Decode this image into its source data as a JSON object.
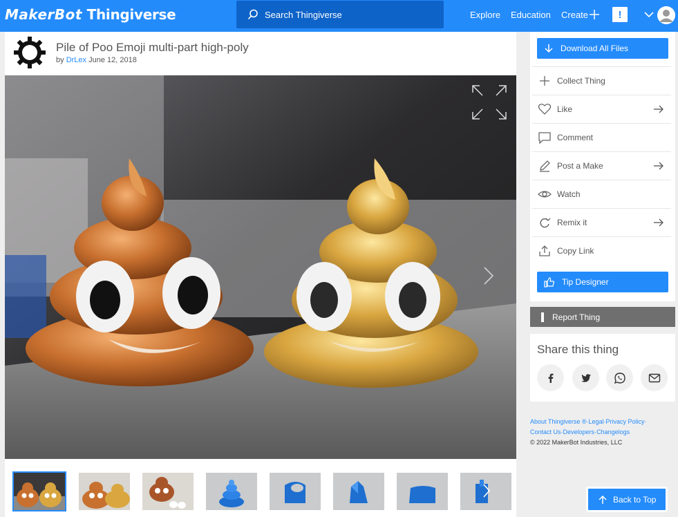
{
  "header": {
    "brand_left": "MakerBot",
    "brand_right": "Thingiverse",
    "search_placeholder": "Search Thingiverse",
    "nav": [
      "Explore",
      "Education",
      "Create"
    ],
    "notification_label": "!",
    "brand_color": "#248bfb"
  },
  "thing": {
    "title": "Pile of Poo Emoji multi-part high-poly",
    "by": "by",
    "author": "DrLex",
    "date": "June 12, 2018"
  },
  "thumbnails_count": 8,
  "sidebar": {
    "download_label": "Download All Files",
    "actions": [
      {
        "label": "Collect Thing",
        "icon": "plus-icon",
        "arrow": false
      },
      {
        "label": "Like",
        "icon": "heart-icon",
        "arrow": true
      },
      {
        "label": "Comment",
        "icon": "comment-icon",
        "arrow": false
      },
      {
        "label": "Post a Make",
        "icon": "pen-icon",
        "arrow": true
      },
      {
        "label": "Watch",
        "icon": "eye-icon",
        "arrow": false
      },
      {
        "label": "Remix it",
        "icon": "remix-icon",
        "arrow": true
      },
      {
        "label": "Copy Link",
        "icon": "share-icon",
        "arrow": false
      }
    ],
    "tip_label": "Tip Designer",
    "report_label": "Report Thing"
  },
  "share": {
    "title": "Share this thing",
    "networks": [
      "facebook-icon",
      "twitter-icon",
      "whatsapp-icon",
      "email-icon"
    ]
  },
  "footer": {
    "line1": [
      "About Thingiverse ®",
      "Legal",
      "Privacy Policy"
    ],
    "line2": [
      "Contact Us",
      "Developers",
      "Changelogs"
    ],
    "copyright": "©  2022  MakerBot Industries, LLC"
  },
  "back_to_top": "Back to Top"
}
